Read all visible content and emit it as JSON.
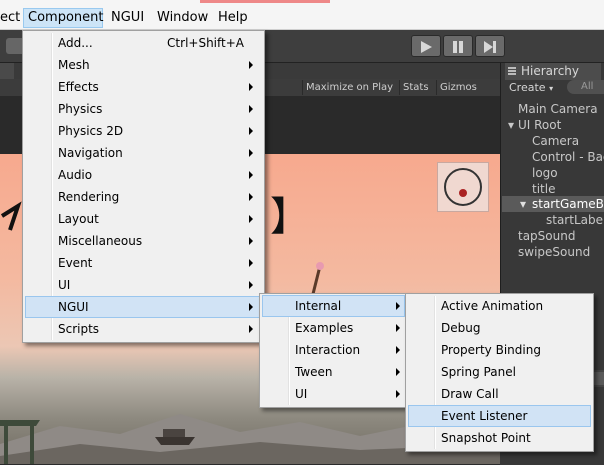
{
  "menubar": {
    "items": [
      "ect",
      "Component",
      "NGUI",
      "Window",
      "Help"
    ],
    "active": "Component"
  },
  "toolbar": {
    "play_icon": "play-icon",
    "pause_icon": "pause-icon",
    "step_icon": "step-icon"
  },
  "game_view": {
    "toolbar_items": [
      "Maximize on Play",
      "Stats",
      "Gizmos"
    ]
  },
  "hierarchy": {
    "tab_label": "Hierarchy",
    "create_label": "Create",
    "search_placeholder": "All",
    "items": [
      "Main Camera",
      "UI Root",
      "Camera",
      "Control - Bac",
      "logo",
      "title",
      "startGameBu",
      "startLabel",
      "tapSound",
      "swipeSound"
    ],
    "selected": "startGameBu"
  },
  "component_menu": {
    "items": [
      {
        "label": "Add...",
        "shortcut": "Ctrl+Shift+A"
      },
      {
        "label": "Mesh"
      },
      {
        "label": "Effects"
      },
      {
        "label": "Physics"
      },
      {
        "label": "Physics 2D"
      },
      {
        "label": "Navigation"
      },
      {
        "label": "Audio"
      },
      {
        "label": "Rendering"
      },
      {
        "label": "Layout"
      },
      {
        "label": "Miscellaneous"
      },
      {
        "label": "Event"
      },
      {
        "label": "UI"
      },
      {
        "label": "NGUI"
      },
      {
        "label": "Scripts"
      }
    ],
    "highlighted": "NGUI"
  },
  "ngui_menu": {
    "items": [
      "Internal",
      "Examples",
      "Interaction",
      "Tween",
      "UI"
    ],
    "highlighted": "Internal"
  },
  "internal_menu": {
    "items": [
      "Active Animation",
      "Debug",
      "Property Binding",
      "Spring Panel",
      "Draw Call",
      "Event Listener",
      "Snapshot Point"
    ],
    "highlighted": "Event Listener"
  },
  "colors": {
    "menu_bg": "#f0f0f0",
    "menu_highlight": "#d1e3f5",
    "editor_dark": "#383838",
    "sky": "#f7a98e"
  }
}
